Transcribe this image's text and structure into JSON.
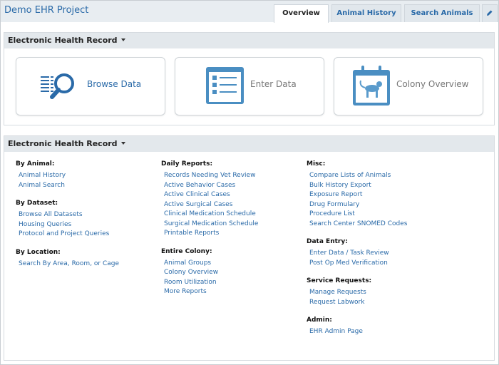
{
  "header": {
    "project_title": "Demo EHR Project",
    "tabs": [
      {
        "label": "Overview",
        "active": true
      },
      {
        "label": "Animal History",
        "active": false
      },
      {
        "label": "Search Animals",
        "active": false
      }
    ],
    "edit_icon": "pencil-icon"
  },
  "panel1": {
    "title": "Electronic Health Record",
    "tiles": [
      {
        "label": "Browse Data",
        "icon": "browse-magnifier-icon",
        "color": "#2a6aa8"
      },
      {
        "label": "Enter Data",
        "icon": "clipboard-list-icon",
        "color": "#777777"
      },
      {
        "label": "Colony Overview",
        "icon": "calendar-monkey-icon",
        "color": "#777777"
      }
    ]
  },
  "panel2": {
    "title": "Electronic Health Record",
    "columns": [
      {
        "groups": [
          {
            "title": "By Animal:",
            "links": [
              "Animal History",
              "Animal Search"
            ]
          },
          {
            "title": "By Dataset:",
            "links": [
              "Browse All Datasets",
              "Housing Queries",
              "Protocol and Project Queries"
            ]
          },
          {
            "title": "By Location:",
            "links": [
              "Search By Area, Room, or Cage"
            ]
          }
        ]
      },
      {
        "groups": [
          {
            "title": "Daily Reports:",
            "links": [
              "Records Needing Vet Review",
              "Active Behavior Cases",
              "Active Clinical Cases",
              "Active Surgical Cases",
              "Clinical Medication Schedule",
              "Surgical Medication Schedule",
              "Printable Reports"
            ]
          },
          {
            "title": "Entire Colony:",
            "links": [
              "Animal Groups",
              "Colony Overview",
              "Room Utilization",
              "More Reports"
            ]
          }
        ]
      },
      {
        "groups": [
          {
            "title": "Misc:",
            "links": [
              "Compare Lists of Animals",
              "Bulk History Export",
              "Exposure Report",
              "Drug Formulary",
              "Procedure List",
              "Search Center SNOMED Codes"
            ]
          },
          {
            "title": "Data Entry:",
            "links": [
              "Enter Data / Task Review",
              "Post Op Med Verification"
            ]
          },
          {
            "title": "Service Requests:",
            "links": [
              "Manage Requests",
              "Request Labwork"
            ]
          },
          {
            "title": "Admin:",
            "links": [
              "EHR Admin Page"
            ]
          }
        ]
      }
    ]
  }
}
